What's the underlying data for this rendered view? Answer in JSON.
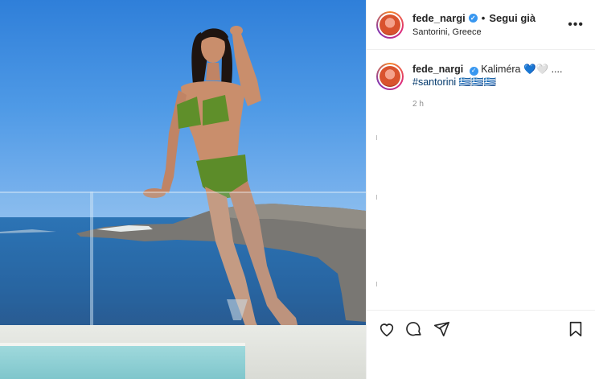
{
  "post": {
    "username": "fede_nargi",
    "follow_label": "Segui già",
    "location": "Santorini, Greece",
    "more_label": "•••",
    "caption": {
      "text": "Kaliméra 💙🤍 ....",
      "hashtag": "#santorini 🇬🇷🇬🇷🇬🇷",
      "time": "2 h"
    }
  },
  "icons": {
    "like": "heart-icon",
    "comment": "comment-icon",
    "share": "share-icon",
    "save": "bookmark-icon",
    "verified": "verified-badge-icon"
  },
  "colors": {
    "verified": "#3897f0",
    "hashtag": "#00376b",
    "sky": "#2f7fd9",
    "sea": "#0a4d92"
  }
}
